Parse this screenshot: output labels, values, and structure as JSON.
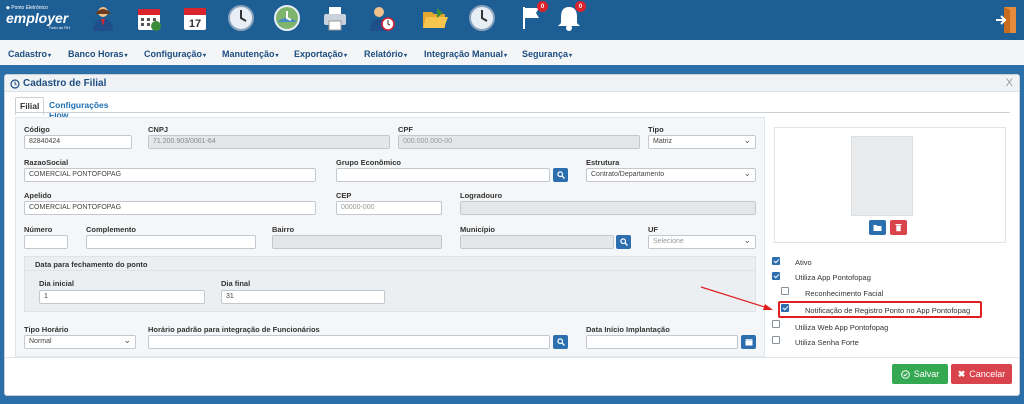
{
  "logo": {
    "pre": "◆ Ponto Eletrônico",
    "brand": "employer",
    "tagline": "Tudo do RH"
  },
  "toolbar": {
    "icons": [
      {
        "name": "employee-icon"
      },
      {
        "name": "calendar-grid-icon"
      },
      {
        "name": "calendar-17-icon",
        "day": "17"
      },
      {
        "name": "clock-icon"
      },
      {
        "name": "clock-map-icon"
      },
      {
        "name": "printer-icon"
      },
      {
        "name": "user-clock-icon"
      },
      {
        "name": "folder-open-icon"
      },
      {
        "name": "clock-grid-icon"
      }
    ],
    "flag_badge": "0",
    "bell_badge": "0"
  },
  "menu": {
    "items": [
      "Cadastro",
      "Banco Horas",
      "Configuração",
      "Manutenção",
      "Exportação",
      "Relatório",
      "Integração Manual",
      "Segurança"
    ]
  },
  "modal": {
    "title": "Cadastro de Filial",
    "close": "X",
    "tabs": [
      "Filial",
      "Configurações Flow"
    ]
  },
  "form": {
    "codigo": {
      "label": "Código",
      "value": "82840424"
    },
    "cnpj": {
      "label": "CNPJ",
      "value": "71.200.903/0001-64"
    },
    "cpf": {
      "label": "CPF",
      "placeholder": "000.000.000-00"
    },
    "tipo": {
      "label": "Tipo",
      "value": "Matriz"
    },
    "razao_social": {
      "label": "RazaoSocial",
      "value": "COMERCIAL PONTOFOPAG"
    },
    "grupo_economico": {
      "label": "Grupo Econômico",
      "value": ""
    },
    "estrutura": {
      "label": "Estrutura",
      "value": "Contrato/Departamento"
    },
    "apelido": {
      "label": "Apelido",
      "value": "COMERCIAL PONTOFOPAG"
    },
    "cep": {
      "label": "CEP",
      "placeholder": "00000-000"
    },
    "logradouro": {
      "label": "Logradouro",
      "value": ""
    },
    "numero": {
      "label": "Número",
      "value": ""
    },
    "complemento": {
      "label": "Complemento",
      "value": ""
    },
    "bairro": {
      "label": "Bairro",
      "value": ""
    },
    "municipio": {
      "label": "Município",
      "value": ""
    },
    "uf": {
      "label": "UF",
      "value": "Selecione"
    },
    "fechamento": {
      "title": "Data para fechamento do ponto",
      "dia_inicial": {
        "label": "Dia inicial",
        "value": "1"
      },
      "dia_final": {
        "label": "Dia final",
        "value": "31"
      }
    },
    "tipo_horario": {
      "label": "Tipo Horário",
      "value": "Normal"
    },
    "horario_padrao": {
      "label": "Horário padrão para integração de Funcionários",
      "value": ""
    },
    "data_implantacao": {
      "label": "Data Início Implantação",
      "value": ""
    }
  },
  "options": [
    {
      "label": "Ativo",
      "checked": true
    },
    {
      "label": "Utiliza App Pontofopag",
      "checked": true
    },
    {
      "label": "Reconhecimento Facial",
      "checked": false
    },
    {
      "label": "Notificação de Registro Ponto no App Pontofopag",
      "checked": true
    },
    {
      "label": "Utiliza Web App Pontofopag",
      "checked": false
    },
    {
      "label": "Utiliza Senha Forte",
      "checked": false
    }
  ],
  "buttons": {
    "save": "Salvar",
    "cancel": "Cancelar"
  },
  "colors": {
    "primary": "#2c6eae",
    "save": "#35a852",
    "cancel": "#d9434b",
    "highlight": "#e02020",
    "header": "#1d5e95"
  }
}
